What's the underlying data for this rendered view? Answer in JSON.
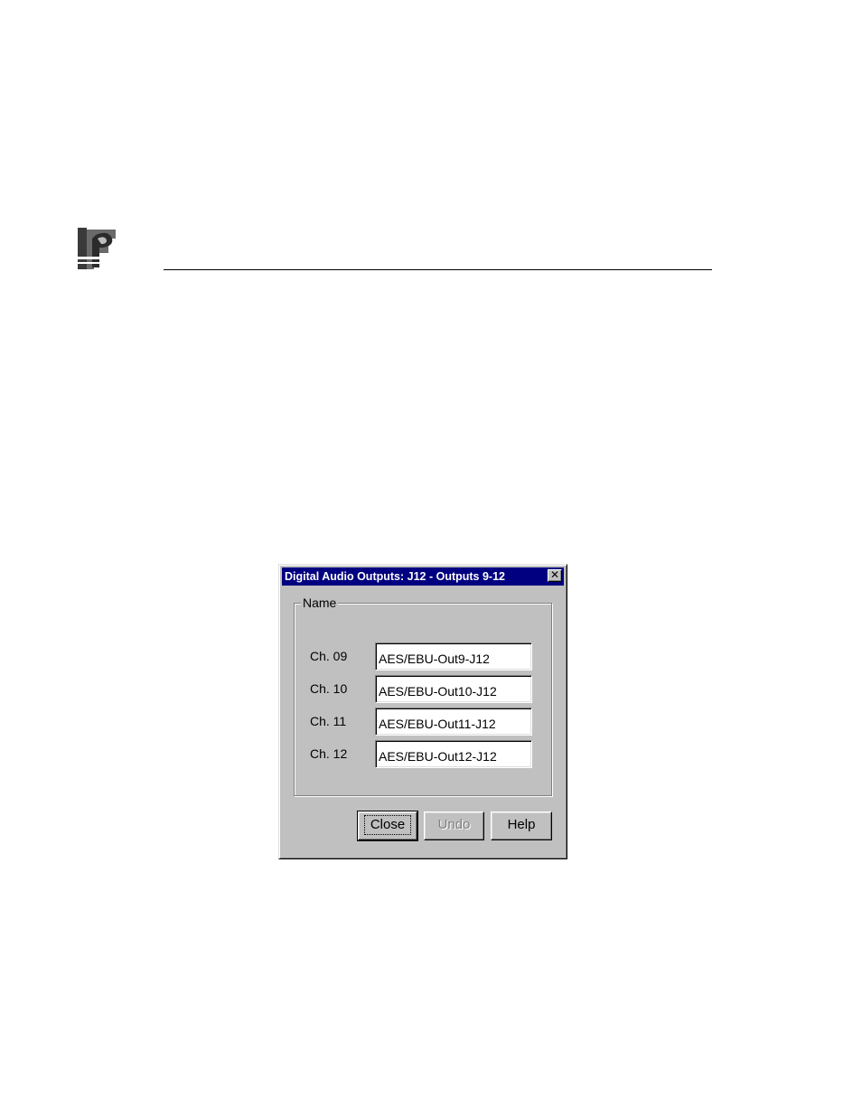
{
  "dialog": {
    "title": "Digital Audio Outputs: J12 - Outputs 9-12",
    "group_label": "Name",
    "channels": [
      {
        "label": "Ch. 09",
        "value": "AES/EBU-Out9-J12"
      },
      {
        "label": "Ch. 10",
        "value": "AES/EBU-Out10-J12"
      },
      {
        "label": "Ch. 11",
        "value": "AES/EBU-Out11-J12"
      },
      {
        "label": "Ch. 12",
        "value": "AES/EBU-Out12-J12"
      }
    ],
    "buttons": {
      "close": "Close",
      "undo": "Undo",
      "help": "Help"
    },
    "close_glyph": "✕"
  },
  "colors": {
    "titlebar": "#000080",
    "dialog_face": "#c0c0c0"
  }
}
